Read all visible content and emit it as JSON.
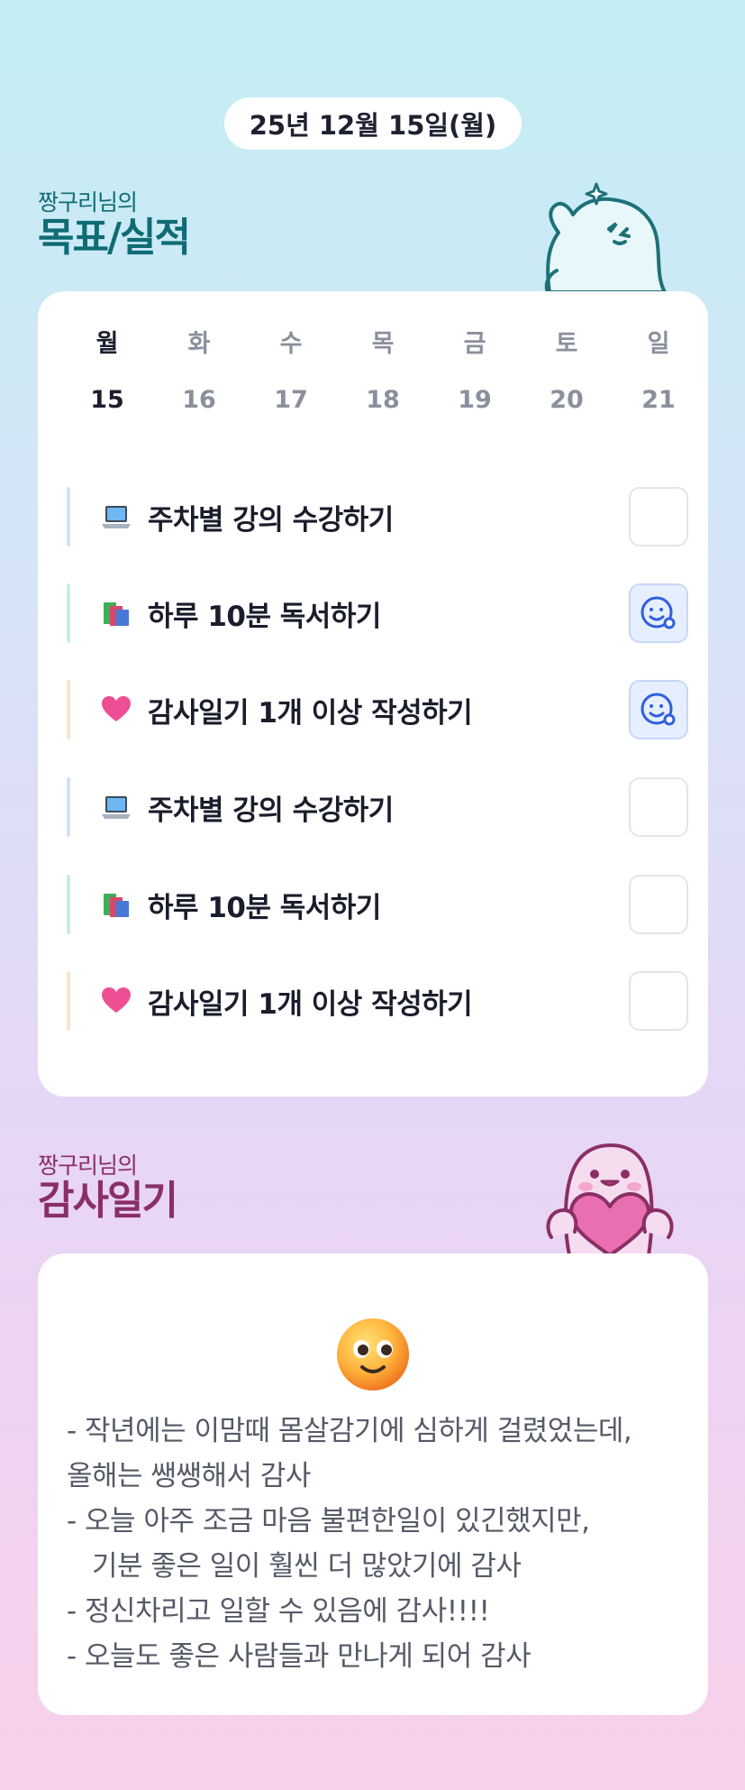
{
  "date_label": "25년 12월 15일(월)",
  "goals_section": {
    "subtitle": "짱구리님의",
    "title": "목표/실적"
  },
  "week": {
    "days": [
      {
        "name": "월",
        "date": "15",
        "active": true
      },
      {
        "name": "화",
        "date": "16",
        "active": false
      },
      {
        "name": "수",
        "date": "17",
        "active": false
      },
      {
        "name": "목",
        "date": "18",
        "active": false
      },
      {
        "name": "금",
        "date": "19",
        "active": false
      },
      {
        "name": "토",
        "date": "20",
        "active": false
      },
      {
        "name": "일",
        "date": "21",
        "active": false
      }
    ]
  },
  "goals": [
    {
      "icon": "laptop-icon",
      "label": "주차별 강의 수강하기",
      "bar_color": "#d3e1f7",
      "done": false
    },
    {
      "icon": "books-icon",
      "label": "하루 10분 독서하기",
      "bar_color": "#c4efe3",
      "done": true
    },
    {
      "icon": "heart-icon",
      "label": "감사일기 1개 이상 작성하기",
      "bar_color": "#fbe4c8",
      "done": true
    },
    {
      "icon": "laptop-icon",
      "label": "주차별 강의 수강하기",
      "bar_color": "#d3e1f7",
      "done": false
    },
    {
      "icon": "books-icon",
      "label": "하루 10분 독서하기",
      "bar_color": "#c4efe3",
      "done": false
    },
    {
      "icon": "heart-icon",
      "label": "감사일기 1개 이상 작성하기",
      "bar_color": "#fbe4c8",
      "done": false
    }
  ],
  "diary_section": {
    "subtitle": "짱구리님의",
    "title": "감사일기"
  },
  "diary": {
    "mood_icon": "smiling-face-icon",
    "lines": [
      "- 작년에는 이맘때 몸살감기에 심하게 걸렸었는데,",
      "올해는 쌩쌩해서 감사",
      "- 오늘 아주 조금 마음 불편한일이 있긴했지만,",
      "기분 좋은 일이 훨씬 더 많았기에 감사",
      "- 정신차리고 일할 수 있음에 감사!!!!",
      "- 오늘도 좋은 사람들과 만나게 되어 감사"
    ]
  },
  "colors": {
    "goals_title": "#0f6b74",
    "diary_title": "#8a2f66",
    "check_done": "#2f5fe0"
  }
}
